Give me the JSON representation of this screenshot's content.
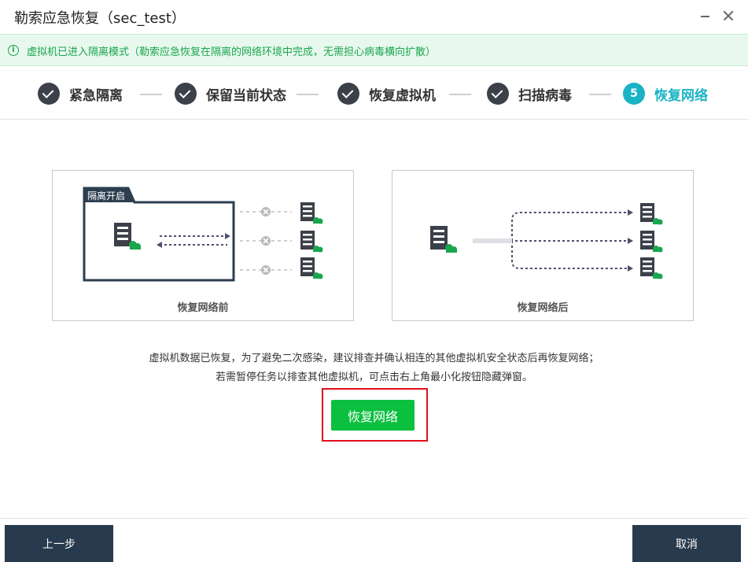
{
  "window": {
    "title": "勒索应急恢复（sec_test）",
    "minimize_icon": "minimize-icon",
    "close_icon": "close-icon"
  },
  "notice": {
    "icon": "info-icon",
    "icon_glyph": "i",
    "text": "虚拟机已进入隔离模式（勒索应急恢复在隔离的网络环境中完成，无需担心病毒横向扩散）",
    "color": "#1aa64e"
  },
  "steps": [
    {
      "label": "紧急隔离",
      "status": "done"
    },
    {
      "label": "保留当前状态",
      "status": "done"
    },
    {
      "label": "恢复虚拟机",
      "status": "done"
    },
    {
      "label": "扫描病毒",
      "status": "done"
    },
    {
      "number": "5",
      "label": "恢复网络",
      "status": "active"
    }
  ],
  "panels": {
    "before": {
      "isolation_tag": "隔离开启",
      "caption": "恢复网络前"
    },
    "after": {
      "caption": "恢复网络后"
    }
  },
  "description": {
    "line1": "虚拟机数据已恢复，为了避免二次感染，建议排查并确认相连的其他虚拟机安全状态后再恢复网络；",
    "line2": "若需暂停任务以排查其他虚拟机，可点击右上角最小化按钮隐藏弹窗。"
  },
  "buttons": {
    "restore": "恢复网络",
    "prev": "上一步",
    "cancel": "取消"
  },
  "colors": {
    "accent": "#1ab3c6",
    "primary_button": "#0bbf3f",
    "footer_button": "#283a4d",
    "highlight": "#e0101a"
  }
}
